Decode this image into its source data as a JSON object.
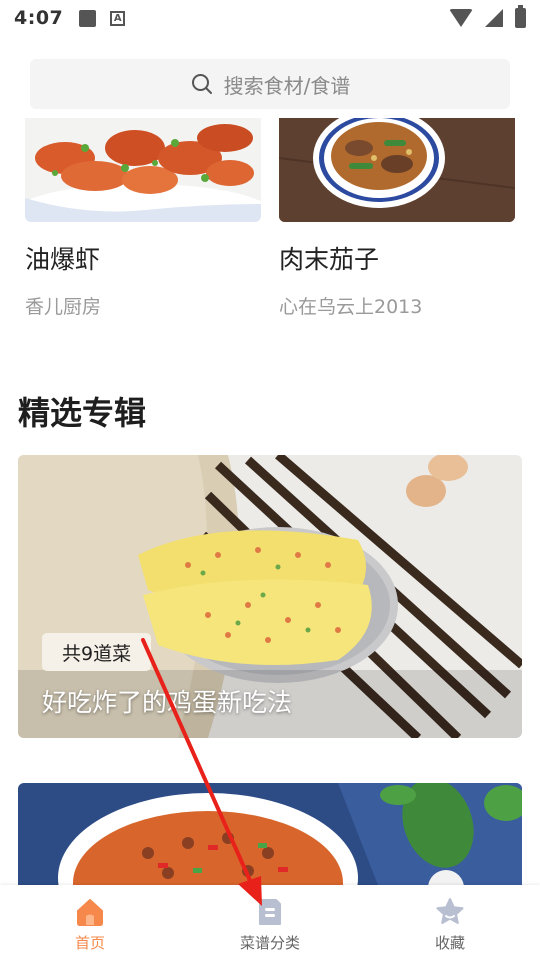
{
  "status_bar": {
    "time": "4:07"
  },
  "search": {
    "placeholder": "搜索食材/食谱"
  },
  "recipes": [
    {
      "title": "油爆虾",
      "author": "香儿厨房",
      "image_icon": "shrimp-dish"
    },
    {
      "title": "肉末茄子",
      "author": "心在乌云上2013",
      "image_icon": "eggplant-dish"
    }
  ],
  "section": {
    "title": "精选专辑"
  },
  "albums": [
    {
      "badge": "共9道菜",
      "title": "好吃炸了的鸡蛋新吃法",
      "image_icon": "egg-pancake"
    },
    {
      "image_icon": "minced-meat-bowl"
    }
  ],
  "tabs": [
    {
      "label": "首页",
      "icon": "home-icon",
      "active": true
    },
    {
      "label": "菜谱分类",
      "icon": "recipe-category-icon",
      "active": false
    },
    {
      "label": "收藏",
      "icon": "star-icon",
      "active": false
    }
  ],
  "colors": {
    "accent": "#f5884a",
    "inactive_icon": "#b8bfd1",
    "arrow": "#e8211a"
  }
}
